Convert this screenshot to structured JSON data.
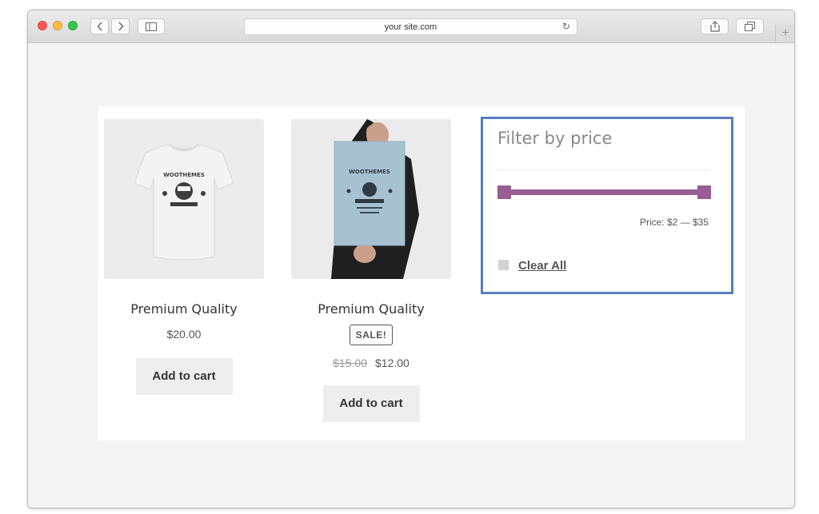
{
  "browser": {
    "url": "your site.com"
  },
  "products": [
    {
      "name": "Premium Quality",
      "price": "$20.00",
      "add_to_cart": "Add to cart",
      "print_text": "WOOTHEMES"
    },
    {
      "name": "Premium Quality",
      "sale_badge": "SALE!",
      "old_price": "$15.00",
      "price": "$12.00",
      "add_to_cart": "Add to cart",
      "print_text": "WOOTHEMES"
    }
  ],
  "filter": {
    "title": "Filter by price",
    "price_label": "Price: $2 — $35",
    "range_min_fraction": 0,
    "range_max_fraction": 1,
    "clear_all": "Clear All",
    "accent_color": "#985d93",
    "highlight_border_color": "#5b7cc2"
  }
}
